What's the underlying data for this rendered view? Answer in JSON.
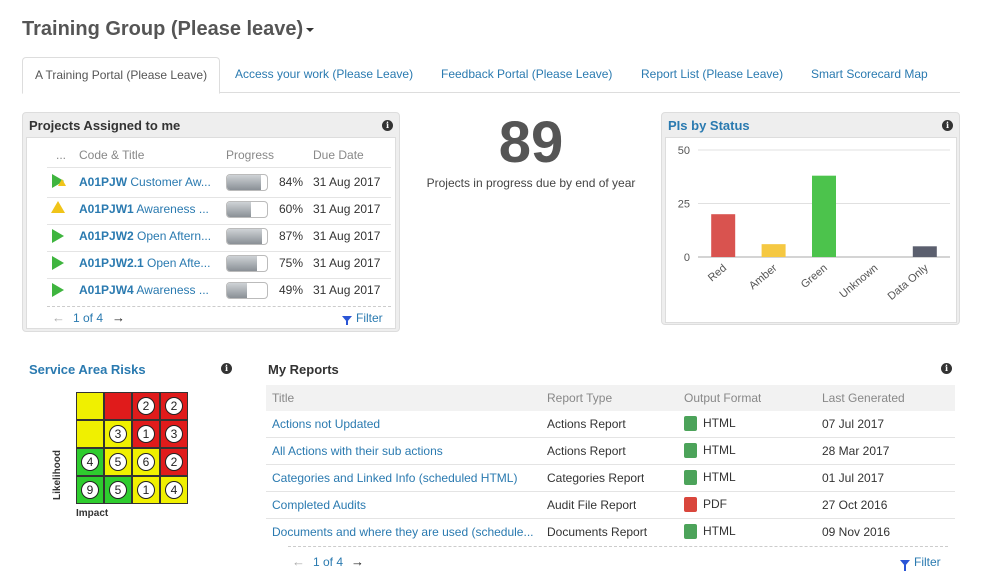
{
  "header": {
    "group_title": "Training Group (Please leave)"
  },
  "tabs": [
    {
      "label": "A Training Portal (Please Leave)",
      "active": true
    },
    {
      "label": "Access your work (Please Leave)"
    },
    {
      "label": "Feedback Portal (Please Leave)"
    },
    {
      "label": "Report List (Please Leave)"
    },
    {
      "label": "Smart Scorecard Map"
    }
  ],
  "projects": {
    "title": "Projects Assigned to me",
    "columns": {
      "dots": "...",
      "code_title": "Code & Title",
      "progress": "Progress",
      "due_date": "Due Date"
    },
    "rows": [
      {
        "status": "play-warn",
        "code": "A01PJW",
        "title": "Customer Aw...",
        "progress_pct": 84,
        "progress_label": "84%",
        "due": "31 Aug 2017"
      },
      {
        "status": "warn",
        "code": "A01PJW1",
        "title": "Awareness ...",
        "progress_pct": 60,
        "progress_label": "60%",
        "due": "31 Aug 2017"
      },
      {
        "status": "play",
        "code": "A01PJW2",
        "title": "Open Aftern...",
        "progress_pct": 87,
        "progress_label": "87%",
        "due": "31 Aug 2017"
      },
      {
        "status": "play",
        "code": "A01PJW2.1",
        "title": "Open Afte...",
        "progress_pct": 75,
        "progress_label": "75%",
        "due": "31 Aug 2017"
      },
      {
        "status": "play",
        "code": "A01PJW4",
        "title": "Awareness ...",
        "progress_pct": 49,
        "progress_label": "49%",
        "due": "31 Aug 2017"
      }
    ],
    "pager": "1 of 4",
    "filter_label": "Filter"
  },
  "kpi": {
    "value": "89",
    "caption": "Projects in progress due by end of year"
  },
  "pis_chart": {
    "title": "PIs by Status",
    "chart_data": {
      "type": "bar",
      "categories": [
        "Red",
        "Amber",
        "Green",
        "Unknown",
        "Data Only"
      ],
      "values": [
        20,
        6,
        38,
        0,
        5
      ],
      "colors": [
        "#d9534f",
        "#f5c842",
        "#4cc34c",
        "#cccccc",
        "#5b5f6e"
      ],
      "yticks": [
        "0",
        "25",
        "50"
      ],
      "ylim": [
        0,
        50
      ],
      "title": "PIs by Status",
      "xlabel": "",
      "ylabel": ""
    }
  },
  "risks": {
    "title": "Service Area Risks",
    "ylabel": "Likelihood",
    "xlabel": "Impact",
    "grid": [
      [
        {
          "c": "#f0f000",
          "n": ""
        },
        {
          "c": "#e01b1b",
          "n": ""
        },
        {
          "c": "#e01b1b",
          "n": "2"
        },
        {
          "c": "#e01b1b",
          "n": "2"
        }
      ],
      [
        {
          "c": "#f0f000",
          "n": ""
        },
        {
          "c": "#f0f000",
          "n": "3"
        },
        {
          "c": "#e01b1b",
          "n": "1"
        },
        {
          "c": "#e01b1b",
          "n": "3"
        }
      ],
      [
        {
          "c": "#2ecc2e",
          "n": "4"
        },
        {
          "c": "#f0f000",
          "n": "5"
        },
        {
          "c": "#f0f000",
          "n": "6"
        },
        {
          "c": "#e01b1b",
          "n": "2"
        }
      ],
      [
        {
          "c": "#2ecc2e",
          "n": "9"
        },
        {
          "c": "#2ecc2e",
          "n": "5"
        },
        {
          "c": "#f0f000",
          "n": "1"
        },
        {
          "c": "#f0f000",
          "n": "4"
        }
      ]
    ]
  },
  "reports": {
    "title": "My Reports",
    "columns": {
      "title": "Title",
      "type": "Report Type",
      "format": "Output Format",
      "generated": "Last Generated"
    },
    "rows": [
      {
        "title": "Actions not Updated",
        "type": "Actions Report",
        "format": "HTML",
        "format_icon": "html-file-icon",
        "generated": "07 Jul 2017"
      },
      {
        "title": "All Actions with their sub actions",
        "type": "Actions Report",
        "format": "HTML",
        "format_icon": "html-file-icon",
        "generated": "28 Mar 2017"
      },
      {
        "title": "Categories and Linked Info (scheduled HTML)",
        "type": "Categories Report",
        "format": "HTML",
        "format_icon": "html-file-icon",
        "generated": "01 Jul 2017"
      },
      {
        "title": "Completed Audits",
        "type": "Audit File Report",
        "format": "PDF",
        "format_icon": "pdf-file-icon",
        "generated": "27 Oct 2016"
      },
      {
        "title": "Documents and where they are used (schedule...",
        "type": "Documents Report",
        "format": "HTML",
        "format_icon": "html-file-icon",
        "generated": "09 Nov 2016"
      }
    ],
    "pager": "1 of 4",
    "filter_label": "Filter"
  },
  "icons": {
    "info": "i",
    "prev": "←",
    "next": "→"
  },
  "colors": {
    "link": "#2a7ab0",
    "html_icon": "#4ca35a",
    "pdf_icon": "#d9463c"
  }
}
